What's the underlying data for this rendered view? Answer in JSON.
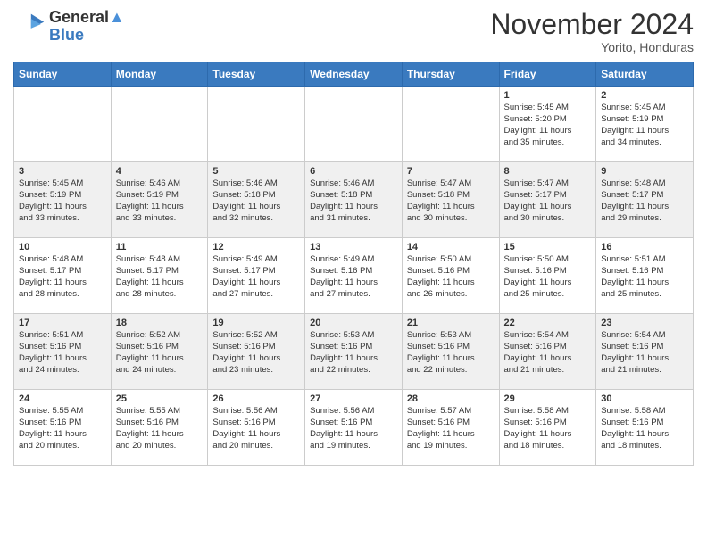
{
  "header": {
    "logo_line1": "General",
    "logo_line2": "Blue",
    "month": "November 2024",
    "location": "Yorito, Honduras"
  },
  "days_of_week": [
    "Sunday",
    "Monday",
    "Tuesday",
    "Wednesday",
    "Thursday",
    "Friday",
    "Saturday"
  ],
  "weeks": [
    [
      {
        "day": "",
        "info": ""
      },
      {
        "day": "",
        "info": ""
      },
      {
        "day": "",
        "info": ""
      },
      {
        "day": "",
        "info": ""
      },
      {
        "day": "",
        "info": ""
      },
      {
        "day": "1",
        "info": "Sunrise: 5:45 AM\nSunset: 5:20 PM\nDaylight: 11 hours\nand 35 minutes."
      },
      {
        "day": "2",
        "info": "Sunrise: 5:45 AM\nSunset: 5:19 PM\nDaylight: 11 hours\nand 34 minutes."
      }
    ],
    [
      {
        "day": "3",
        "info": "Sunrise: 5:45 AM\nSunset: 5:19 PM\nDaylight: 11 hours\nand 33 minutes."
      },
      {
        "day": "4",
        "info": "Sunrise: 5:46 AM\nSunset: 5:19 PM\nDaylight: 11 hours\nand 33 minutes."
      },
      {
        "day": "5",
        "info": "Sunrise: 5:46 AM\nSunset: 5:18 PM\nDaylight: 11 hours\nand 32 minutes."
      },
      {
        "day": "6",
        "info": "Sunrise: 5:46 AM\nSunset: 5:18 PM\nDaylight: 11 hours\nand 31 minutes."
      },
      {
        "day": "7",
        "info": "Sunrise: 5:47 AM\nSunset: 5:18 PM\nDaylight: 11 hours\nand 30 minutes."
      },
      {
        "day": "8",
        "info": "Sunrise: 5:47 AM\nSunset: 5:17 PM\nDaylight: 11 hours\nand 30 minutes."
      },
      {
        "day": "9",
        "info": "Sunrise: 5:48 AM\nSunset: 5:17 PM\nDaylight: 11 hours\nand 29 minutes."
      }
    ],
    [
      {
        "day": "10",
        "info": "Sunrise: 5:48 AM\nSunset: 5:17 PM\nDaylight: 11 hours\nand 28 minutes."
      },
      {
        "day": "11",
        "info": "Sunrise: 5:48 AM\nSunset: 5:17 PM\nDaylight: 11 hours\nand 28 minutes."
      },
      {
        "day": "12",
        "info": "Sunrise: 5:49 AM\nSunset: 5:17 PM\nDaylight: 11 hours\nand 27 minutes."
      },
      {
        "day": "13",
        "info": "Sunrise: 5:49 AM\nSunset: 5:16 PM\nDaylight: 11 hours\nand 27 minutes."
      },
      {
        "day": "14",
        "info": "Sunrise: 5:50 AM\nSunset: 5:16 PM\nDaylight: 11 hours\nand 26 minutes."
      },
      {
        "day": "15",
        "info": "Sunrise: 5:50 AM\nSunset: 5:16 PM\nDaylight: 11 hours\nand 25 minutes."
      },
      {
        "day": "16",
        "info": "Sunrise: 5:51 AM\nSunset: 5:16 PM\nDaylight: 11 hours\nand 25 minutes."
      }
    ],
    [
      {
        "day": "17",
        "info": "Sunrise: 5:51 AM\nSunset: 5:16 PM\nDaylight: 11 hours\nand 24 minutes."
      },
      {
        "day": "18",
        "info": "Sunrise: 5:52 AM\nSunset: 5:16 PM\nDaylight: 11 hours\nand 24 minutes."
      },
      {
        "day": "19",
        "info": "Sunrise: 5:52 AM\nSunset: 5:16 PM\nDaylight: 11 hours\nand 23 minutes."
      },
      {
        "day": "20",
        "info": "Sunrise: 5:53 AM\nSunset: 5:16 PM\nDaylight: 11 hours\nand 22 minutes."
      },
      {
        "day": "21",
        "info": "Sunrise: 5:53 AM\nSunset: 5:16 PM\nDaylight: 11 hours\nand 22 minutes."
      },
      {
        "day": "22",
        "info": "Sunrise: 5:54 AM\nSunset: 5:16 PM\nDaylight: 11 hours\nand 21 minutes."
      },
      {
        "day": "23",
        "info": "Sunrise: 5:54 AM\nSunset: 5:16 PM\nDaylight: 11 hours\nand 21 minutes."
      }
    ],
    [
      {
        "day": "24",
        "info": "Sunrise: 5:55 AM\nSunset: 5:16 PM\nDaylight: 11 hours\nand 20 minutes."
      },
      {
        "day": "25",
        "info": "Sunrise: 5:55 AM\nSunset: 5:16 PM\nDaylight: 11 hours\nand 20 minutes."
      },
      {
        "day": "26",
        "info": "Sunrise: 5:56 AM\nSunset: 5:16 PM\nDaylight: 11 hours\nand 20 minutes."
      },
      {
        "day": "27",
        "info": "Sunrise: 5:56 AM\nSunset: 5:16 PM\nDaylight: 11 hours\nand 19 minutes."
      },
      {
        "day": "28",
        "info": "Sunrise: 5:57 AM\nSunset: 5:16 PM\nDaylight: 11 hours\nand 19 minutes."
      },
      {
        "day": "29",
        "info": "Sunrise: 5:58 AM\nSunset: 5:16 PM\nDaylight: 11 hours\nand 18 minutes."
      },
      {
        "day": "30",
        "info": "Sunrise: 5:58 AM\nSunset: 5:16 PM\nDaylight: 11 hours\nand 18 minutes."
      }
    ]
  ]
}
